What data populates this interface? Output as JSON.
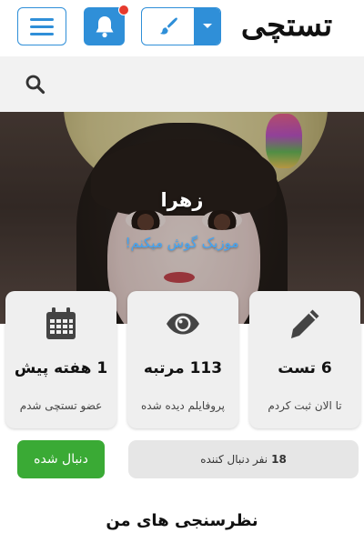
{
  "header": {
    "logo_text": "تستچی",
    "menu_icon": "hamburger-menu-icon",
    "notification_icon": "bell-icon",
    "has_unread_notification": true,
    "theme_icon": "paint-brush-icon",
    "dropdown_icon": "caret-down-icon",
    "colors": {
      "accent": "#2f8fd8",
      "badge": "#e63a2e"
    }
  },
  "search": {
    "placeholder": "",
    "value": "",
    "icon": "search-icon"
  },
  "profile": {
    "name": "زهرا",
    "bio": "موزیک گوش میکنم!",
    "cover_image": "avatar-girl-with-hat"
  },
  "stats": {
    "joined": {
      "icon": "calendar-icon",
      "value": "1 هفته پیش",
      "caption": "عضو تستچی شدم"
    },
    "views": {
      "icon": "eye-icon",
      "value": "113 مرتبه",
      "caption": "پروفایلم دیده شده"
    },
    "tests": {
      "icon": "pencil-icon",
      "value": "6 تست",
      "caption": "تا الان ثبت کردم"
    }
  },
  "follow": {
    "button_label": "دنبال شده",
    "followers_count": "18",
    "followers_label": "نفر دنبال کننده",
    "colors": {
      "button": "#3aaa35"
    }
  },
  "section": {
    "title": "نظرسنجی های من"
  }
}
